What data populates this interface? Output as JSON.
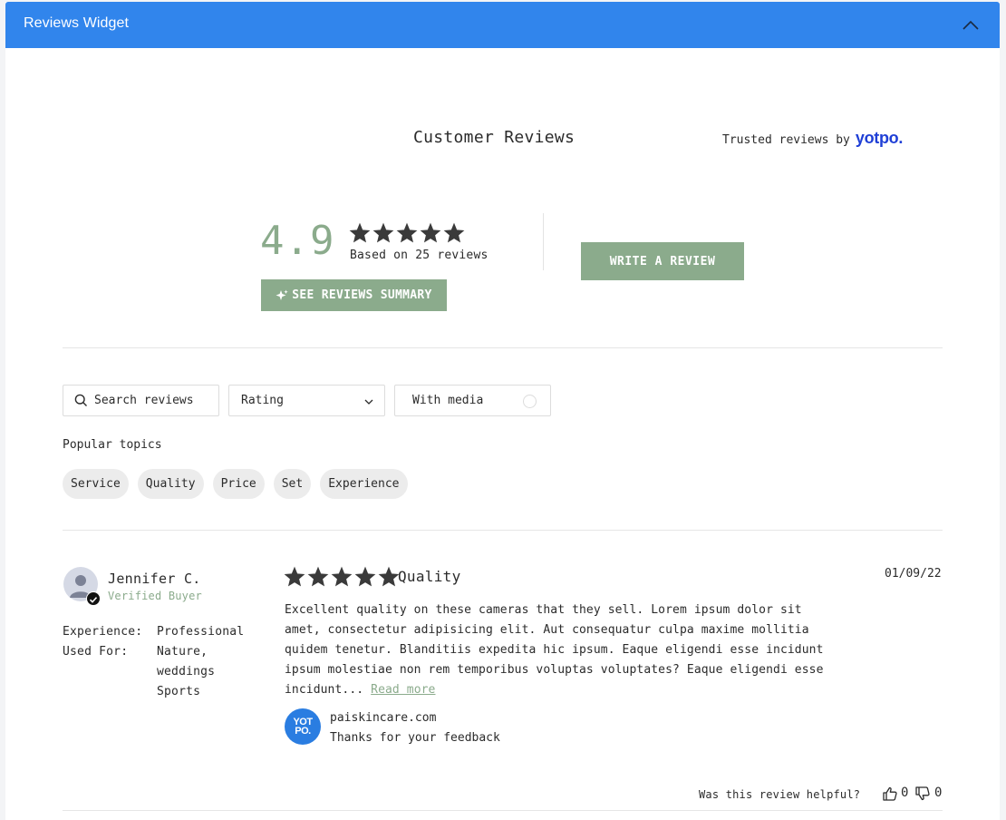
{
  "header": {
    "title": "Reviews Widget",
    "collapse_icon": "chevron-up-icon"
  },
  "widget": {
    "title": "Customer Reviews",
    "trusted_prefix": "Trusted reviews by",
    "brand": "yotpo."
  },
  "summary": {
    "average": "4.9",
    "stars": 5,
    "based_on": "Based on 25 reviews",
    "summary_button": "SEE REVIEWS SUMMARY",
    "write_button": "WRITE A REVIEW"
  },
  "filters": {
    "search_placeholder": "Search reviews",
    "rating_label": "Rating",
    "media_label": "With media"
  },
  "topics": {
    "label": "Popular topics",
    "items": [
      "Service",
      "Quality",
      "Price",
      "Set",
      "Experience"
    ]
  },
  "review": {
    "name": "Jennifer C.",
    "badge": "Verified Buyer",
    "experience_label": "Experience:",
    "experience_value": "Professional",
    "used_for_label": "Used For:",
    "used_for_values": [
      "Nature,",
      "weddings",
      "Sports"
    ],
    "stars": 5,
    "title": "Quality",
    "date": "01/09/22",
    "body": "Excellent quality on these cameras that they sell. Lorem ipsum dolor sit amet, consectetur adipisicing elit. Aut consequatur culpa maxime mollitia quidem tenetur. Blanditiis expedita hic ipsum. Eaque eligendi esse incidunt ipsum molestiae non rem temporibus voluptas voluptates? Eaque eligendi esse incidunt...",
    "read_more": "Read more",
    "store_logo_text": "YOT PO.",
    "store_name": "paiskincare.com",
    "store_reply": "Thanks for your feedback",
    "helpful_text": "Was this review helpful?",
    "thumbs_up": "0",
    "thumbs_down": "0"
  },
  "colors": {
    "header_blue": "#3185ec",
    "accent_green": "#8bab8c",
    "star": "#3a3a3a",
    "yotpo_blue": "#1f3fd6"
  }
}
